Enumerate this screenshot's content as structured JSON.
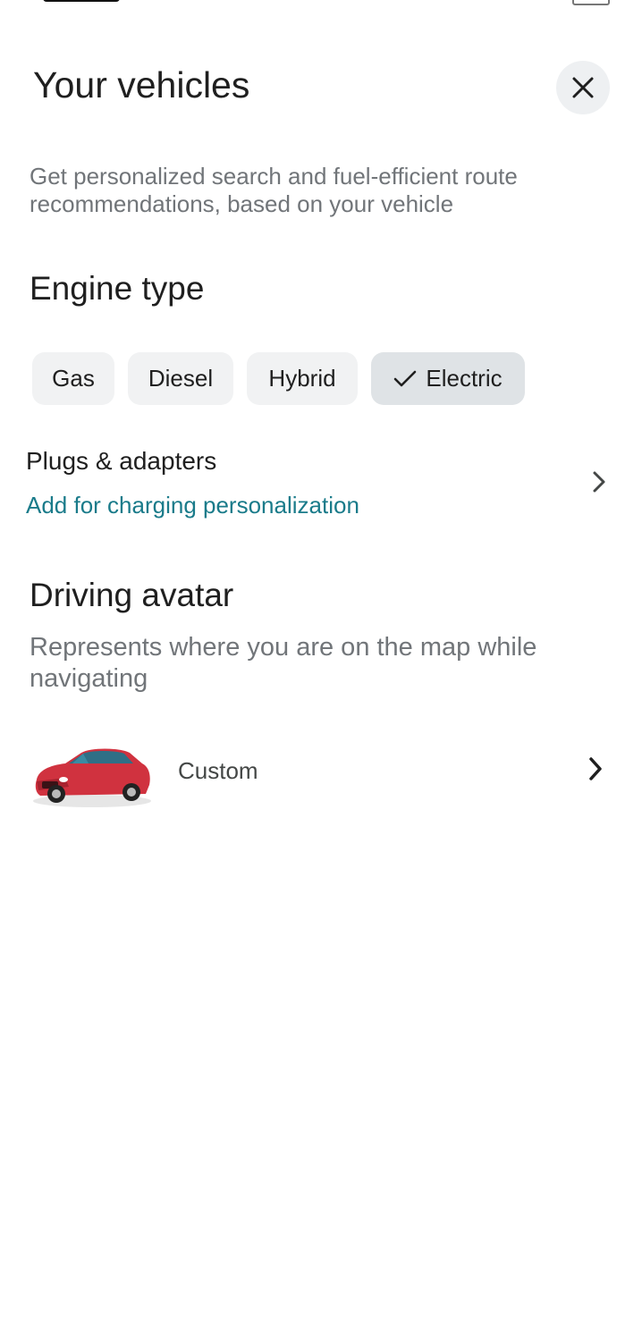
{
  "header": {
    "title": "Your vehicles",
    "close_icon": "close-icon",
    "subtitle": "Get personalized search and fuel-efficient route recommendations, based on your vehicle"
  },
  "engine": {
    "heading": "Engine type",
    "options": [
      {
        "label": "Gas",
        "selected": false
      },
      {
        "label": "Diesel",
        "selected": false
      },
      {
        "label": "Hybrid",
        "selected": false
      },
      {
        "label": "Electric",
        "selected": true
      }
    ],
    "check_icon": "check-icon"
  },
  "plugs": {
    "label": "Plugs & adapters",
    "sublabel": "Add for charging personalization",
    "icon": "chevron-right-icon"
  },
  "avatar": {
    "heading": "Driving avatar",
    "description": "Represents where you are on the map while navigating",
    "option_label": "Custom",
    "image_icon": "red-car-icon",
    "chevron_icon": "chevron-right-icon"
  },
  "colors": {
    "accent_link": "#1a7b8a",
    "selected_chip": "#dfe3e6",
    "chip": "#f1f2f3",
    "car": "#d0323f"
  }
}
